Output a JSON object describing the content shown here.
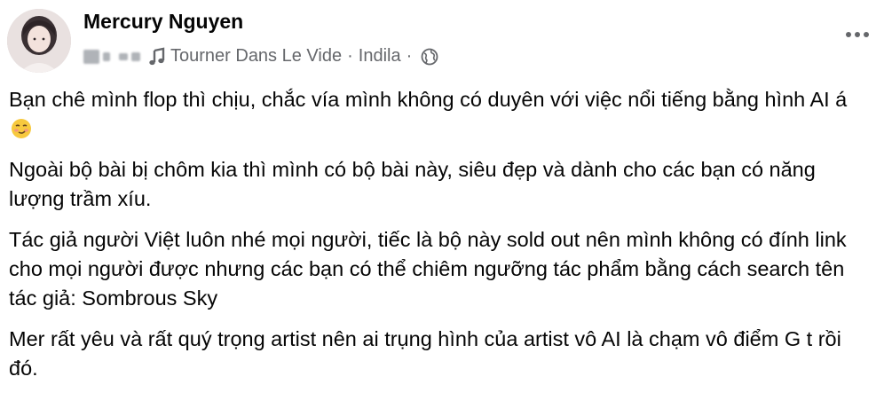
{
  "post": {
    "author": "Mercury Nguyen",
    "song_title": "Tourner Dans Le Vide",
    "song_separator": "·",
    "song_artist": "Indila",
    "audience_separator": "·",
    "audience_icon": "globe-icon",
    "music_icon": "music-note-icon",
    "more_icon": "more-options-icon"
  },
  "content": {
    "p1": "Bạn chê mình flop thì chịu, chắc vía mình không có duyên với việc nổi tiếng bằng hình AI á",
    "p1_emoji": "smirking-face-emoji",
    "p2": "Ngoài bộ bài bị chôm kia thì mình có bộ bài này, siêu đẹp và dành cho các bạn có năng lượng trầm xíu.",
    "p3": "Tác giả người Việt luôn nhé mọi người, tiếc là bộ này sold out nên mình không có đính link cho mọi người được nhưng các bạn có thể chiêm ngưỡng tác phẩm bằng cách search tên tác giả: Sombrous Sky",
    "p4": "Mer rất yêu và rất quý trọng artist nên ai trụng hình của artist vô AI là chạm vô điểm G t rồi đó."
  },
  "colors": {
    "text": "#050505",
    "secondary_text": "#65676b",
    "background": "#ffffff"
  }
}
